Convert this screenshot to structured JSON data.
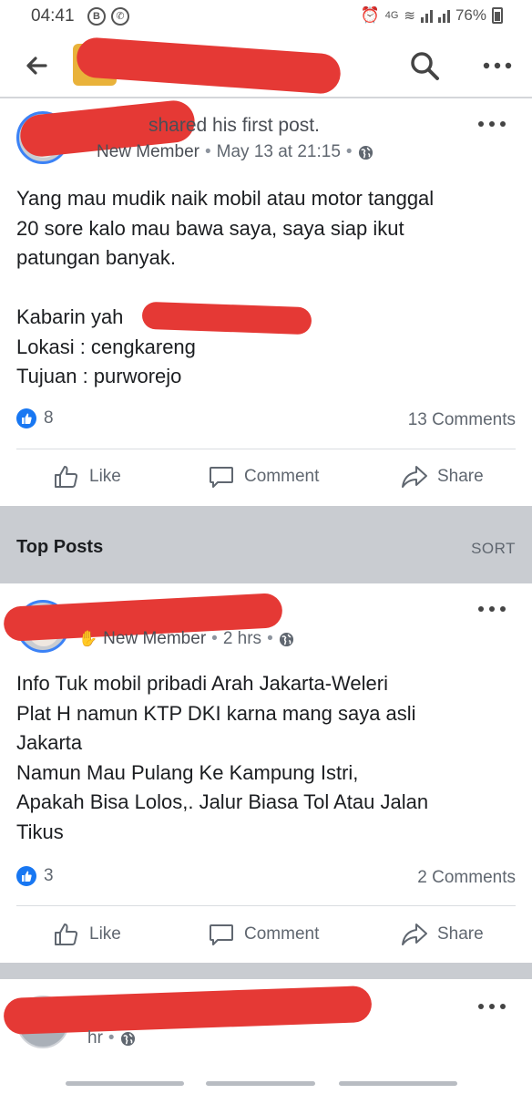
{
  "status_bar": {
    "time": "04:41",
    "network": "4G",
    "battery": "76%"
  },
  "app_bar": {
    "icons": [
      "arrow-left-icon",
      "search-icon",
      "more-horizontal-icon"
    ]
  },
  "posts": [
    {
      "headline": "shared his first post.",
      "role": "New Member",
      "time": "May 13 at 21:15",
      "privacy_icon": "globe-icon",
      "body_lines": [
        "Yang mau mudik naik mobil atau motor tanggal",
        "20 sore kalo mau bawa saya, saya siap ikut",
        "patungan banyak.",
        "",
        "Kabarin yah",
        "Lokasi : cengkareng",
        "Tujuan : purworejo"
      ],
      "likes": "8",
      "comments": "13 Comments"
    },
    {
      "role": "New Member",
      "time": "2 hrs",
      "privacy_icon": "globe-icon",
      "body_lines": [
        "Info Tuk mobil pribadi Arah Jakarta-Weleri",
        "Plat H namun KTP DKI karna mang saya asli",
        "Jakarta",
        "Namun Mau Pulang Ke Kampung Istri,",
        "Apakah Bisa Lolos,. Jalur Biasa Tol Atau Jalan",
        "Tikus"
      ],
      "likes": "3",
      "comments": "2 Comments"
    },
    {
      "time": "hr"
    }
  ],
  "actions": {
    "like": "Like",
    "comment": "Comment",
    "share": "Share"
  },
  "top_posts": {
    "title": "Top Posts",
    "sort": "SORT"
  },
  "colors": {
    "accent": "#1877f2",
    "redaction": "#e53935",
    "separator": "#c9ccd1"
  }
}
